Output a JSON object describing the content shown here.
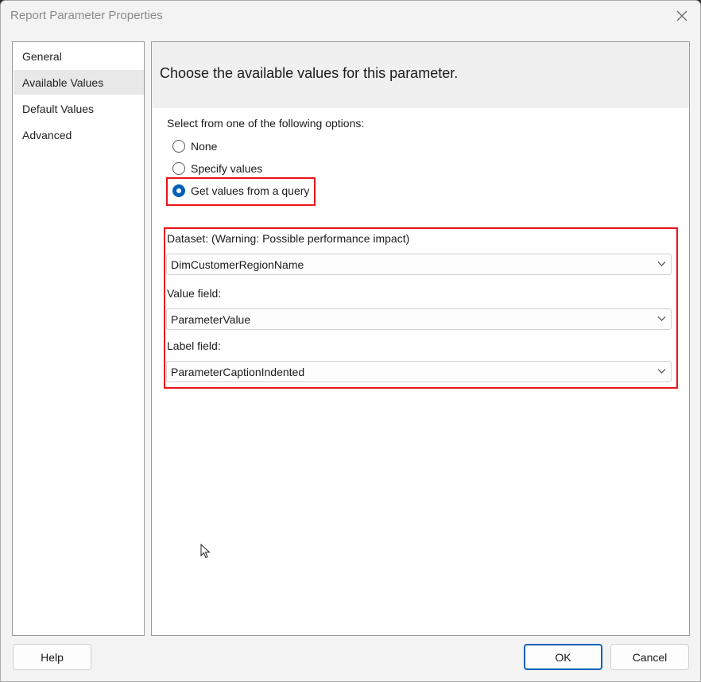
{
  "window": {
    "title": "Report Parameter Properties"
  },
  "nav": {
    "items": [
      {
        "label": "General",
        "selected": false
      },
      {
        "label": "Available Values",
        "selected": true
      },
      {
        "label": "Default Values",
        "selected": false
      },
      {
        "label": "Advanced",
        "selected": false
      }
    ]
  },
  "panel": {
    "heading": "Choose the available values for this parameter.",
    "prompt": "Select from one of the following options:",
    "options": [
      {
        "label": "None",
        "checked": false
      },
      {
        "label": "Specify values",
        "checked": false
      },
      {
        "label": "Get values from a query",
        "checked": true
      }
    ],
    "fields": {
      "dataset_label": "Dataset: (Warning: Possible performance impact)",
      "dataset_value": "DimCustomerRegionName",
      "value_field_label": "Value field:",
      "value_field_value": "ParameterValue",
      "label_field_label": "Label field:",
      "label_field_value": "ParameterCaptionIndented"
    }
  },
  "buttons": {
    "help": "Help",
    "ok": "OK",
    "cancel": "Cancel"
  },
  "colors": {
    "accent": "#005fb8",
    "highlight": "#e8141b"
  },
  "icons": {
    "close": "close-icon",
    "chevron": "chevron-down-icon",
    "cursor": "mouse-pointer-icon"
  }
}
